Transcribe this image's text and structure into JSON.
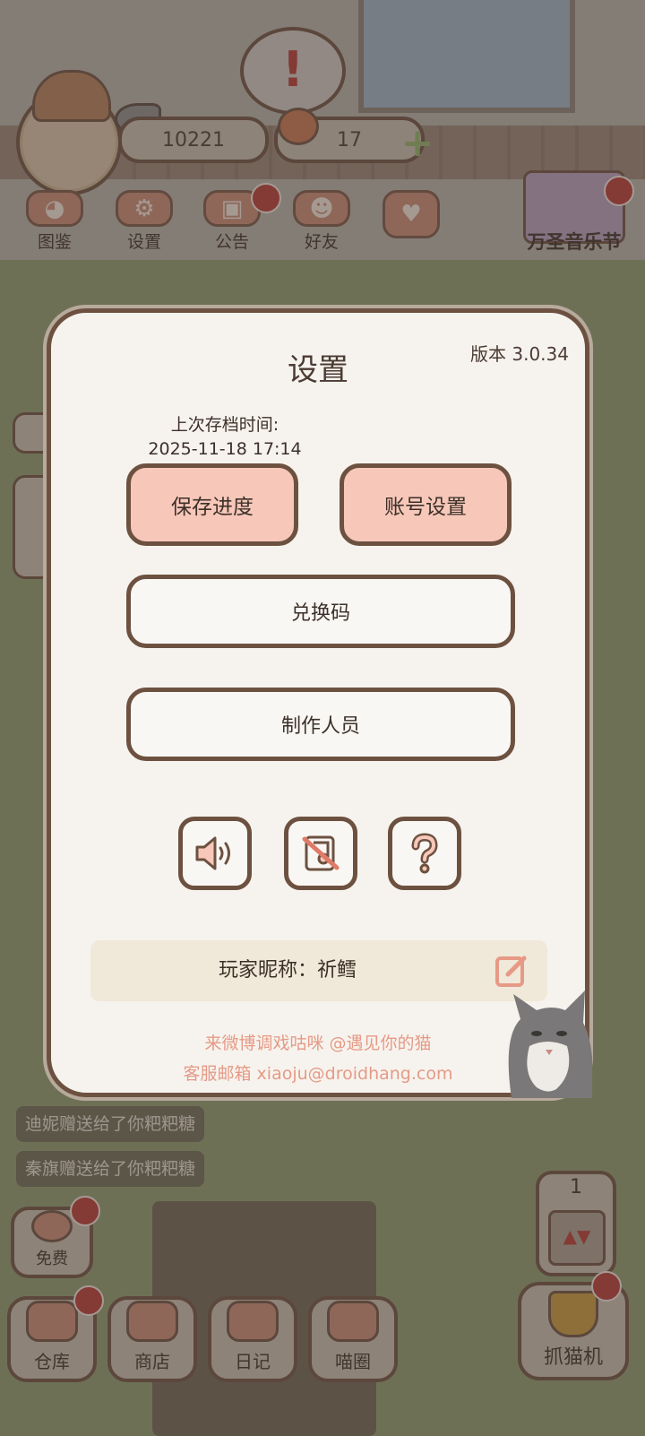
{
  "hud": {
    "fish_count": "10221",
    "heart_count": "17",
    "buttons": [
      {
        "label": "图鉴"
      },
      {
        "label": "设置"
      },
      {
        "label": "公告"
      },
      {
        "label": "好友"
      }
    ],
    "event_label": "万圣音乐节"
  },
  "chat": {
    "messages": [
      "迪妮赠送给了你粑粑糖",
      "秦旗赠送给了你粑粑糖"
    ]
  },
  "bottom": {
    "free_label": "免费",
    "nav": [
      {
        "label": "仓库"
      },
      {
        "label": "商店"
      },
      {
        "label": "日记"
      },
      {
        "label": "喵圈"
      }
    ],
    "claw_label": "抓猫机",
    "claw_count": "1"
  },
  "settings": {
    "title": "设置",
    "version": "版本 3.0.34",
    "last_save_label": "上次存档时间:",
    "last_save_time": "2025-11-18 17:14",
    "save_button": "保存进度",
    "account_button": "账号设置",
    "redeem_button": "兑换码",
    "credits_button": "制作人员",
    "nickname": "玩家昵称：祈鳕",
    "weibo": "来微博调戏咕咪 @遇见你的猫",
    "email": "客服邮箱 xiaoju@droidhang.com"
  },
  "colors": {
    "accent_pink": "#f7c8ba",
    "border_brown": "#6d5140",
    "panel_bg": "#f6f3ee",
    "link_salmon": "#e69a86",
    "badge_red": "#b63a33"
  }
}
